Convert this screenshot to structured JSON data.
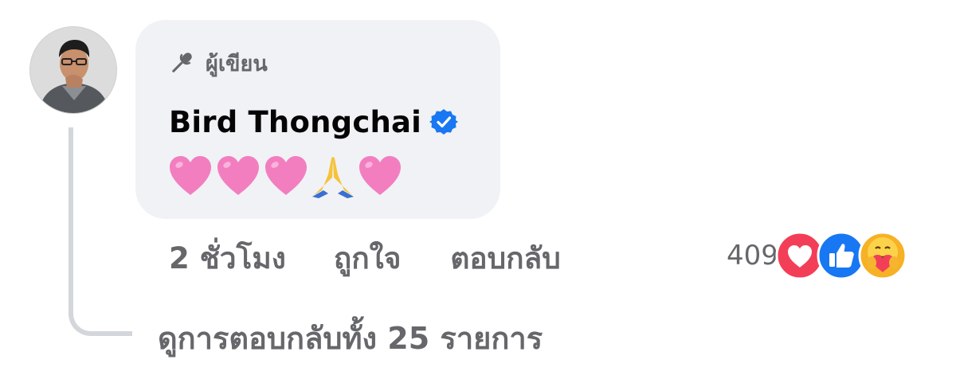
{
  "comment": {
    "author_badge": {
      "icon": "microphone-icon",
      "label": "ผู้เขียน"
    },
    "author_name": "Bird Thongchai",
    "verified_icon": "verified-badge-icon",
    "message_emojis": [
      "pink-heart",
      "pink-heart",
      "pink-heart",
      "folded-hands",
      "pink-heart"
    ],
    "timestamp": "2 ชั่วโมง",
    "like_label": "ถูกใจ",
    "reply_label": "ตอบกลับ",
    "reaction_count": "409",
    "reaction_icons": [
      "love-reaction-icon",
      "like-reaction-icon",
      "care-reaction-icon"
    ],
    "view_replies_label": "ดูการตอบกลับทั้ง 25 รายการ"
  },
  "colors": {
    "bubble_bg": "#f0f2f5",
    "secondary_text": "#65676b",
    "verified_blue": "#1877f2",
    "love_red": "#f33e58",
    "like_blue": "#1877f2",
    "heart_pink": "#f27ec0",
    "thread_line": "#d3d6da"
  }
}
